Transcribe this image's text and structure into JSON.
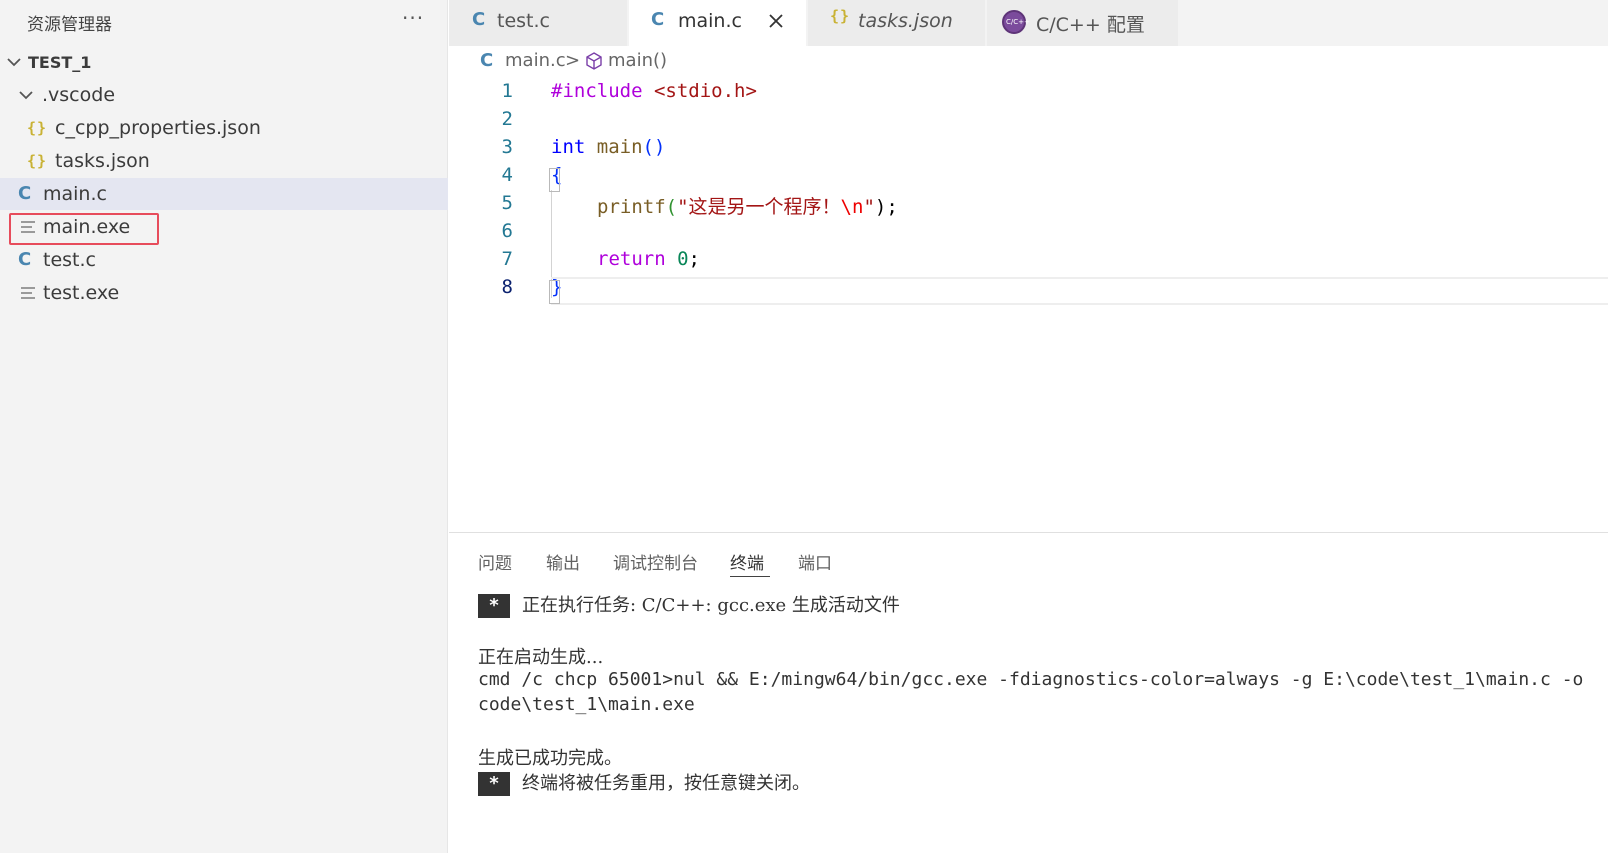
{
  "sidebar": {
    "title": "资源管理器",
    "more_label": "···",
    "root": "TEST_1",
    "folder": ".vscode",
    "items": [
      {
        "label": "c_cpp_properties.json",
        "icon": "json-icon"
      },
      {
        "label": "tasks.json",
        "icon": "json-icon"
      },
      {
        "label": "main.c",
        "icon": "c-file-icon"
      },
      {
        "label": "main.exe",
        "icon": "binary-file-icon"
      },
      {
        "label": "test.c",
        "icon": "c-file-icon"
      },
      {
        "label": "test.exe",
        "icon": "binary-file-icon"
      }
    ]
  },
  "tabs": [
    {
      "label": "test.c",
      "icon": "C"
    },
    {
      "label": "main.c",
      "icon": "C"
    },
    {
      "label": "tasks.json",
      "icon": "{}"
    },
    {
      "label": "C/C++ 配置",
      "icon": "C/C++"
    }
  ],
  "breadcrumb": {
    "file": "main.c",
    "separator": ">",
    "symbol": "main()"
  },
  "editor": {
    "line_numbers": [
      "1",
      "2",
      "3",
      "4",
      "5",
      "6",
      "7",
      "8"
    ],
    "l1_directive": "#include",
    "l1_header": "<stdio.h>",
    "l3_type": "int",
    "l3_fn": "main",
    "l3_parens": "()",
    "l4_brace": "{",
    "l5_fn": "printf",
    "l5_open": "(",
    "l5_str": "\"这是另一个程序！",
    "l5_esc": "\\n",
    "l5_quote": "\"",
    "l5_close": ");",
    "l7_kw": "return",
    "l7_num": "0",
    "l7_semi": ";",
    "l8_brace": "}"
  },
  "panel": {
    "tabs": [
      "问题",
      "输出",
      "调试控制台",
      "终端",
      "端口"
    ],
    "star": "*",
    "task_line": "正在执行任务: C/C++: gcc.exe 生成活动文件",
    "starting": "正在启动生成...",
    "cmd_line1": "cmd /c chcp 65001>nul && E:/mingw64/bin/gcc.exe -fdiagnostics-color=always -g E:\\code\\test_1\\main.c -o",
    "cmd_line2": "code\\test_1\\main.exe",
    "success": "生成已成功完成。",
    "reuse": "终端将被任务重用，按任意键关闭。"
  },
  "colors": {
    "accent_highlight": "#e74c5b",
    "sidebar_bg": "#f3f3f3",
    "selected_row": "#e4e6f1"
  }
}
